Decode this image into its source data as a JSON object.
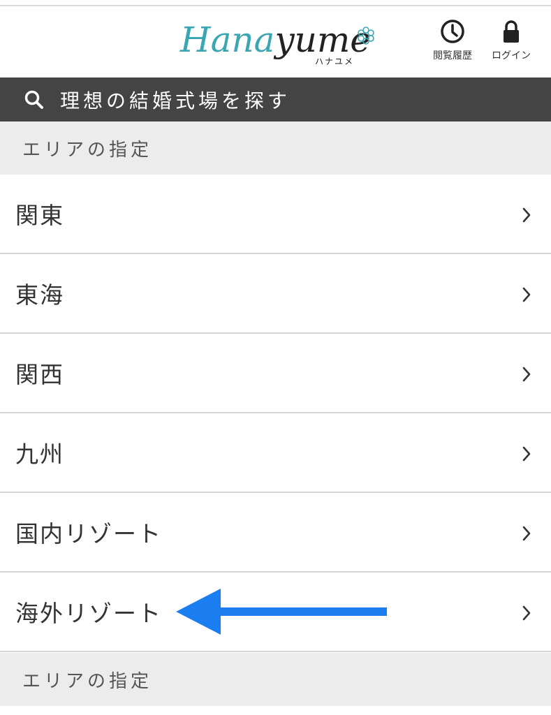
{
  "header": {
    "logo": {
      "text_part1": "Hana",
      "text_part2": "yume",
      "kana": "ハナユメ",
      "brand_color": "#3aa6b2"
    },
    "history_button": {
      "label": "閲覧履歴",
      "icon": "clock-icon"
    },
    "login_button": {
      "label": "ログイン",
      "icon": "lock-icon"
    }
  },
  "search": {
    "label": "理想の結婚式場を探す",
    "icon": "search-icon",
    "background": "#444444"
  },
  "area_section": {
    "title": "エリアの指定",
    "items": [
      {
        "label": "関東",
        "icon": "chevron-right-icon"
      },
      {
        "label": "東海",
        "icon": "chevron-right-icon"
      },
      {
        "label": "関西",
        "icon": "chevron-right-icon"
      },
      {
        "label": "九州",
        "icon": "chevron-right-icon"
      },
      {
        "label": "国内リゾート",
        "icon": "chevron-right-icon"
      },
      {
        "label": "海外リゾート",
        "icon": "chevron-right-icon"
      }
    ]
  },
  "next_section": {
    "title": "エリアの指定"
  },
  "annotation": {
    "icon": "arrow-left-icon",
    "color": "#1a7ef0"
  }
}
